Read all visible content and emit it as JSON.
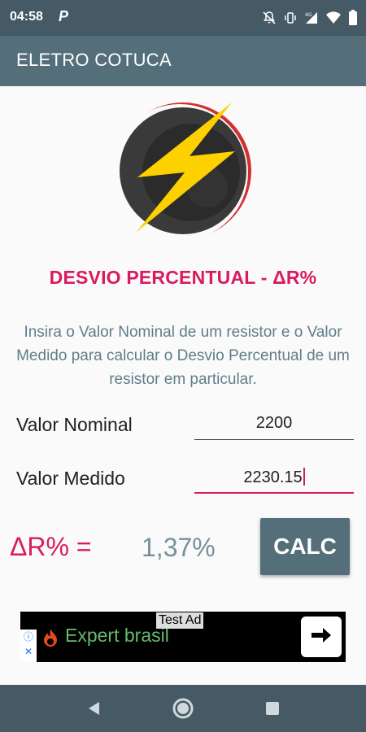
{
  "status_bar": {
    "time": "04:58",
    "app_indicator": "P",
    "icons": [
      "notifications-off-icon",
      "vibrate-icon",
      "lte-signal-icon",
      "wifi-icon",
      "battery-icon"
    ]
  },
  "app_bar": {
    "title": "ELETRO COTUCA"
  },
  "logo": {
    "icon": "lightning-bolt-icon"
  },
  "main": {
    "section_title": "DESVIO PERCENTUAL - ΔR%",
    "description": "Insira o Valor Nominal de um resistor e o Valor Medido para calcular o Desvio Percentual de um resistor em particular.",
    "fields": {
      "nominal": {
        "label": "Valor Nominal",
        "value": "2200"
      },
      "medido": {
        "label": "Valor Medido",
        "value": "2230.15"
      }
    },
    "result": {
      "label": "ΔR% =",
      "value": "1,37%"
    },
    "calc_button": "CALC"
  },
  "ad": {
    "badge": "Test Ad",
    "text": "Expert brasil",
    "info_glyph": "ⓘ",
    "close_glyph": "✕"
  },
  "nav_bar": {
    "icons": [
      "back-icon",
      "home-icon",
      "recents-icon"
    ]
  },
  "colors": {
    "app_bar": "#546e7a",
    "status_bar": "#455a64",
    "accent": "#d81b60",
    "description_text": "#607d8b",
    "result_text": "#78909c"
  }
}
